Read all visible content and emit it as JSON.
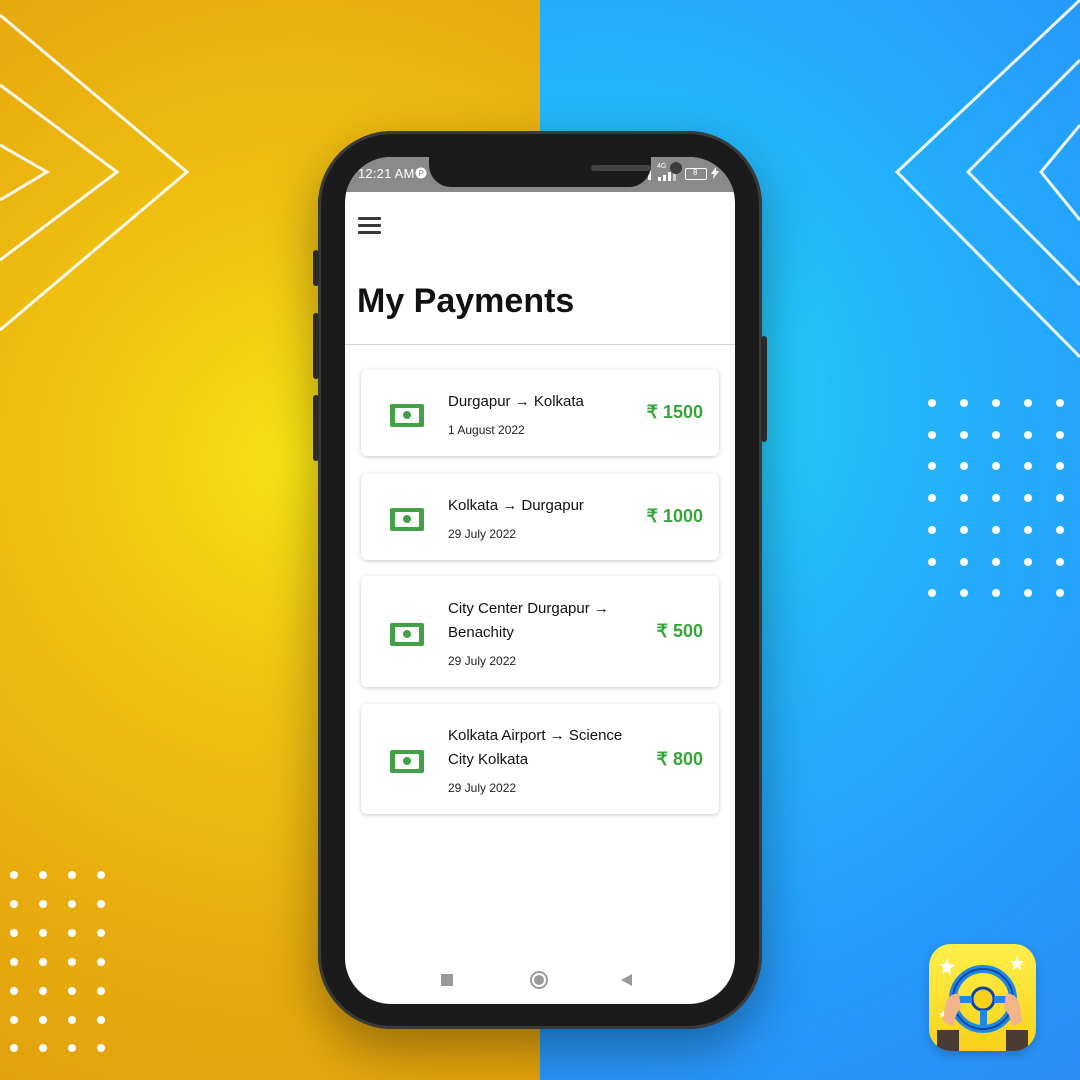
{
  "colors": {
    "accent_green": "#38a53b",
    "cash_green": "#43a047",
    "bg_yellow": "#f0c612",
    "bg_blue": "#23b6fb"
  },
  "status_bar": {
    "time": "12:21 AM",
    "network": "4G",
    "battery": "8"
  },
  "header": {
    "menu_icon": "hamburger-menu-icon",
    "title": "My Payments"
  },
  "payments": [
    {
      "route": "Durgapur → Kolkata",
      "date": "1 August 2022",
      "amount": "₹ 1500",
      "icon": "cash-icon"
    },
    {
      "route": "Kolkata → Durgapur",
      "date": "29 July 2022",
      "amount": "₹ 1000",
      "icon": "cash-icon"
    },
    {
      "route": "City Center Durgapur → Benachity",
      "date": "29 July 2022",
      "amount": "₹ 500",
      "icon": "cash-icon"
    },
    {
      "route": "Kolkata Airport → Science City Kolkata",
      "date": "29 July 2022",
      "amount": "₹ 800",
      "icon": "cash-icon"
    }
  ],
  "nav_bar": {
    "recents_icon": "square-icon",
    "home_icon": "circle-icon",
    "back_icon": "triangle-back-icon"
  },
  "branding": {
    "logo_icon": "steering-wheel-logo"
  }
}
